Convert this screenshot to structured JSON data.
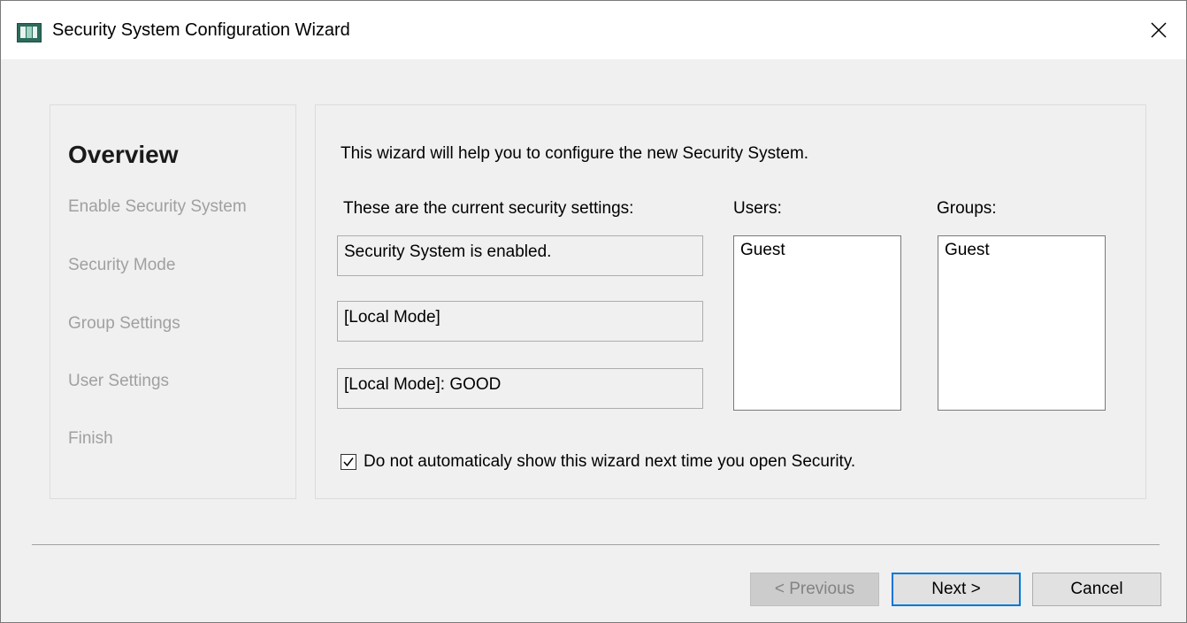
{
  "window": {
    "title": "Security System Configuration Wizard",
    "icon": "app-icon",
    "close_glyph": "✕"
  },
  "steps": {
    "title": "Overview",
    "items": [
      {
        "label": "Enable Security System"
      },
      {
        "label": "Security Mode"
      },
      {
        "label": "Group Settings"
      },
      {
        "label": "User Settings"
      },
      {
        "label": "Finish"
      }
    ]
  },
  "main": {
    "intro": "This wizard will help you to configure the new Security System.",
    "current_label": "These are the current security settings:",
    "status_boxes": [
      "Security System is enabled.",
      "[Local Mode]",
      "[Local Mode]: GOOD"
    ],
    "users_label": "Users:",
    "users": [
      "Guest"
    ],
    "groups_label": "Groups:",
    "groups": [
      "Guest"
    ],
    "checkbox_label": "Do not automaticaly show this wizard next time you open Security.",
    "checkbox_checked": true
  },
  "buttons": {
    "previous": "< Previous",
    "next": "Next >",
    "cancel": "Cancel"
  },
  "colors": {
    "default_button_border": "#0078d7",
    "disabled_text": "#838383",
    "inactive_step": "#a0a0a0"
  }
}
